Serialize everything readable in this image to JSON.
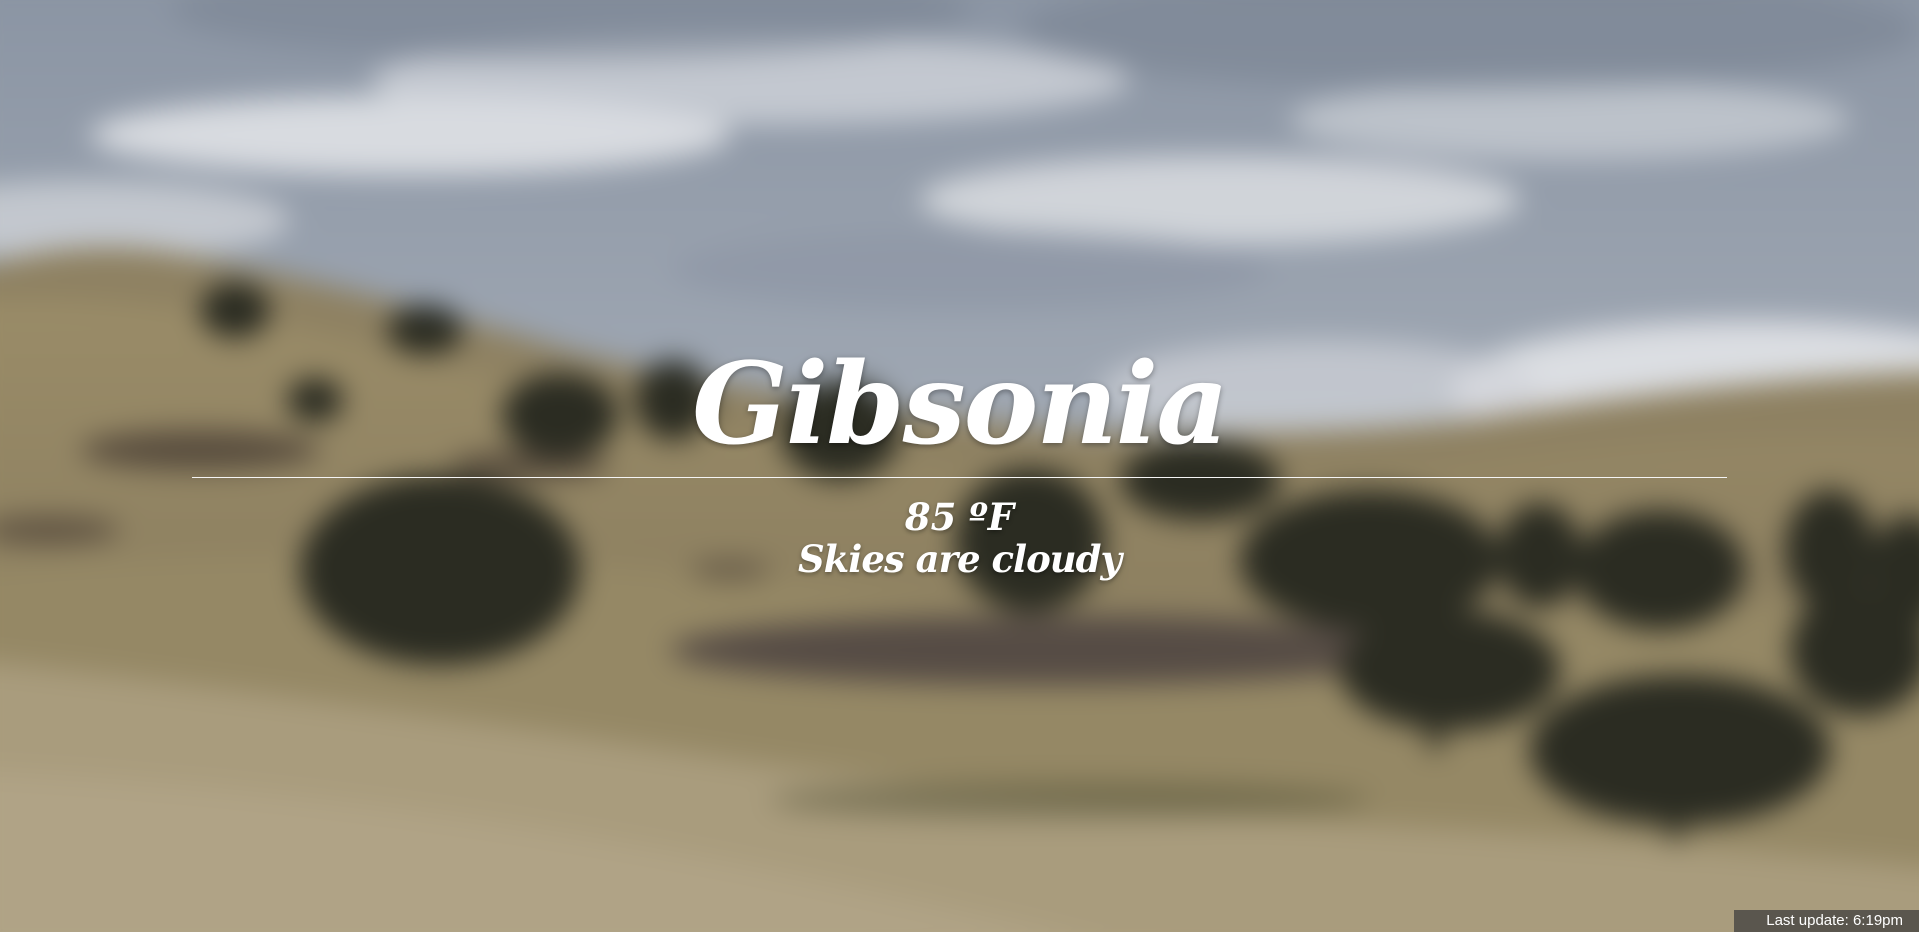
{
  "weather": {
    "city": "Gibsonia",
    "temperature": "85 ºF",
    "condition": "Skies are cloudy"
  },
  "footer": {
    "last_update": "Last update: 6:19pm"
  },
  "background": {
    "scene": "cloudy-sky-over-grassy-hills-with-oak-trees",
    "sky_color": "#8e98a8",
    "grass_color": "#8f8468",
    "tree_color": "#2b2c22"
  }
}
